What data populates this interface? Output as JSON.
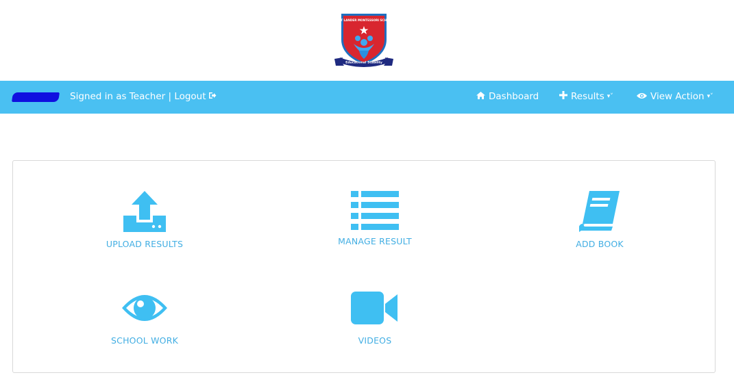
{
  "header": {
    "logo_text_top": "EAST LANDER MONTESSORI SCHOOL",
    "logo_ribbon": "Educational Stability"
  },
  "navbar": {
    "signed_in_text": "Signed in as Teacher | ",
    "logout_label": "Logout",
    "items": [
      {
        "label": "Dashboard",
        "icon": "home-icon"
      },
      {
        "label": "Results",
        "icon": "plus-icon"
      },
      {
        "label": "View Action",
        "icon": "eye-icon"
      }
    ]
  },
  "tiles": [
    {
      "label": "UPLOAD RESULTS",
      "icon": "upload-icon"
    },
    {
      "label": "MANAGE RESULT",
      "icon": "list-icon"
    },
    {
      "label": "ADD BOOK",
      "icon": "book-icon"
    },
    {
      "label": "SCHOOL WORK",
      "icon": "eye-icon"
    },
    {
      "label": "VIDEOS",
      "icon": "video-camera-icon"
    }
  ],
  "colors": {
    "navbar_bg": "#4ac0f2",
    "icon_blue": "#3fbff2",
    "label_blue": "#42aee3",
    "logo_red": "#d8262f",
    "logo_navy": "#1f2a80"
  }
}
